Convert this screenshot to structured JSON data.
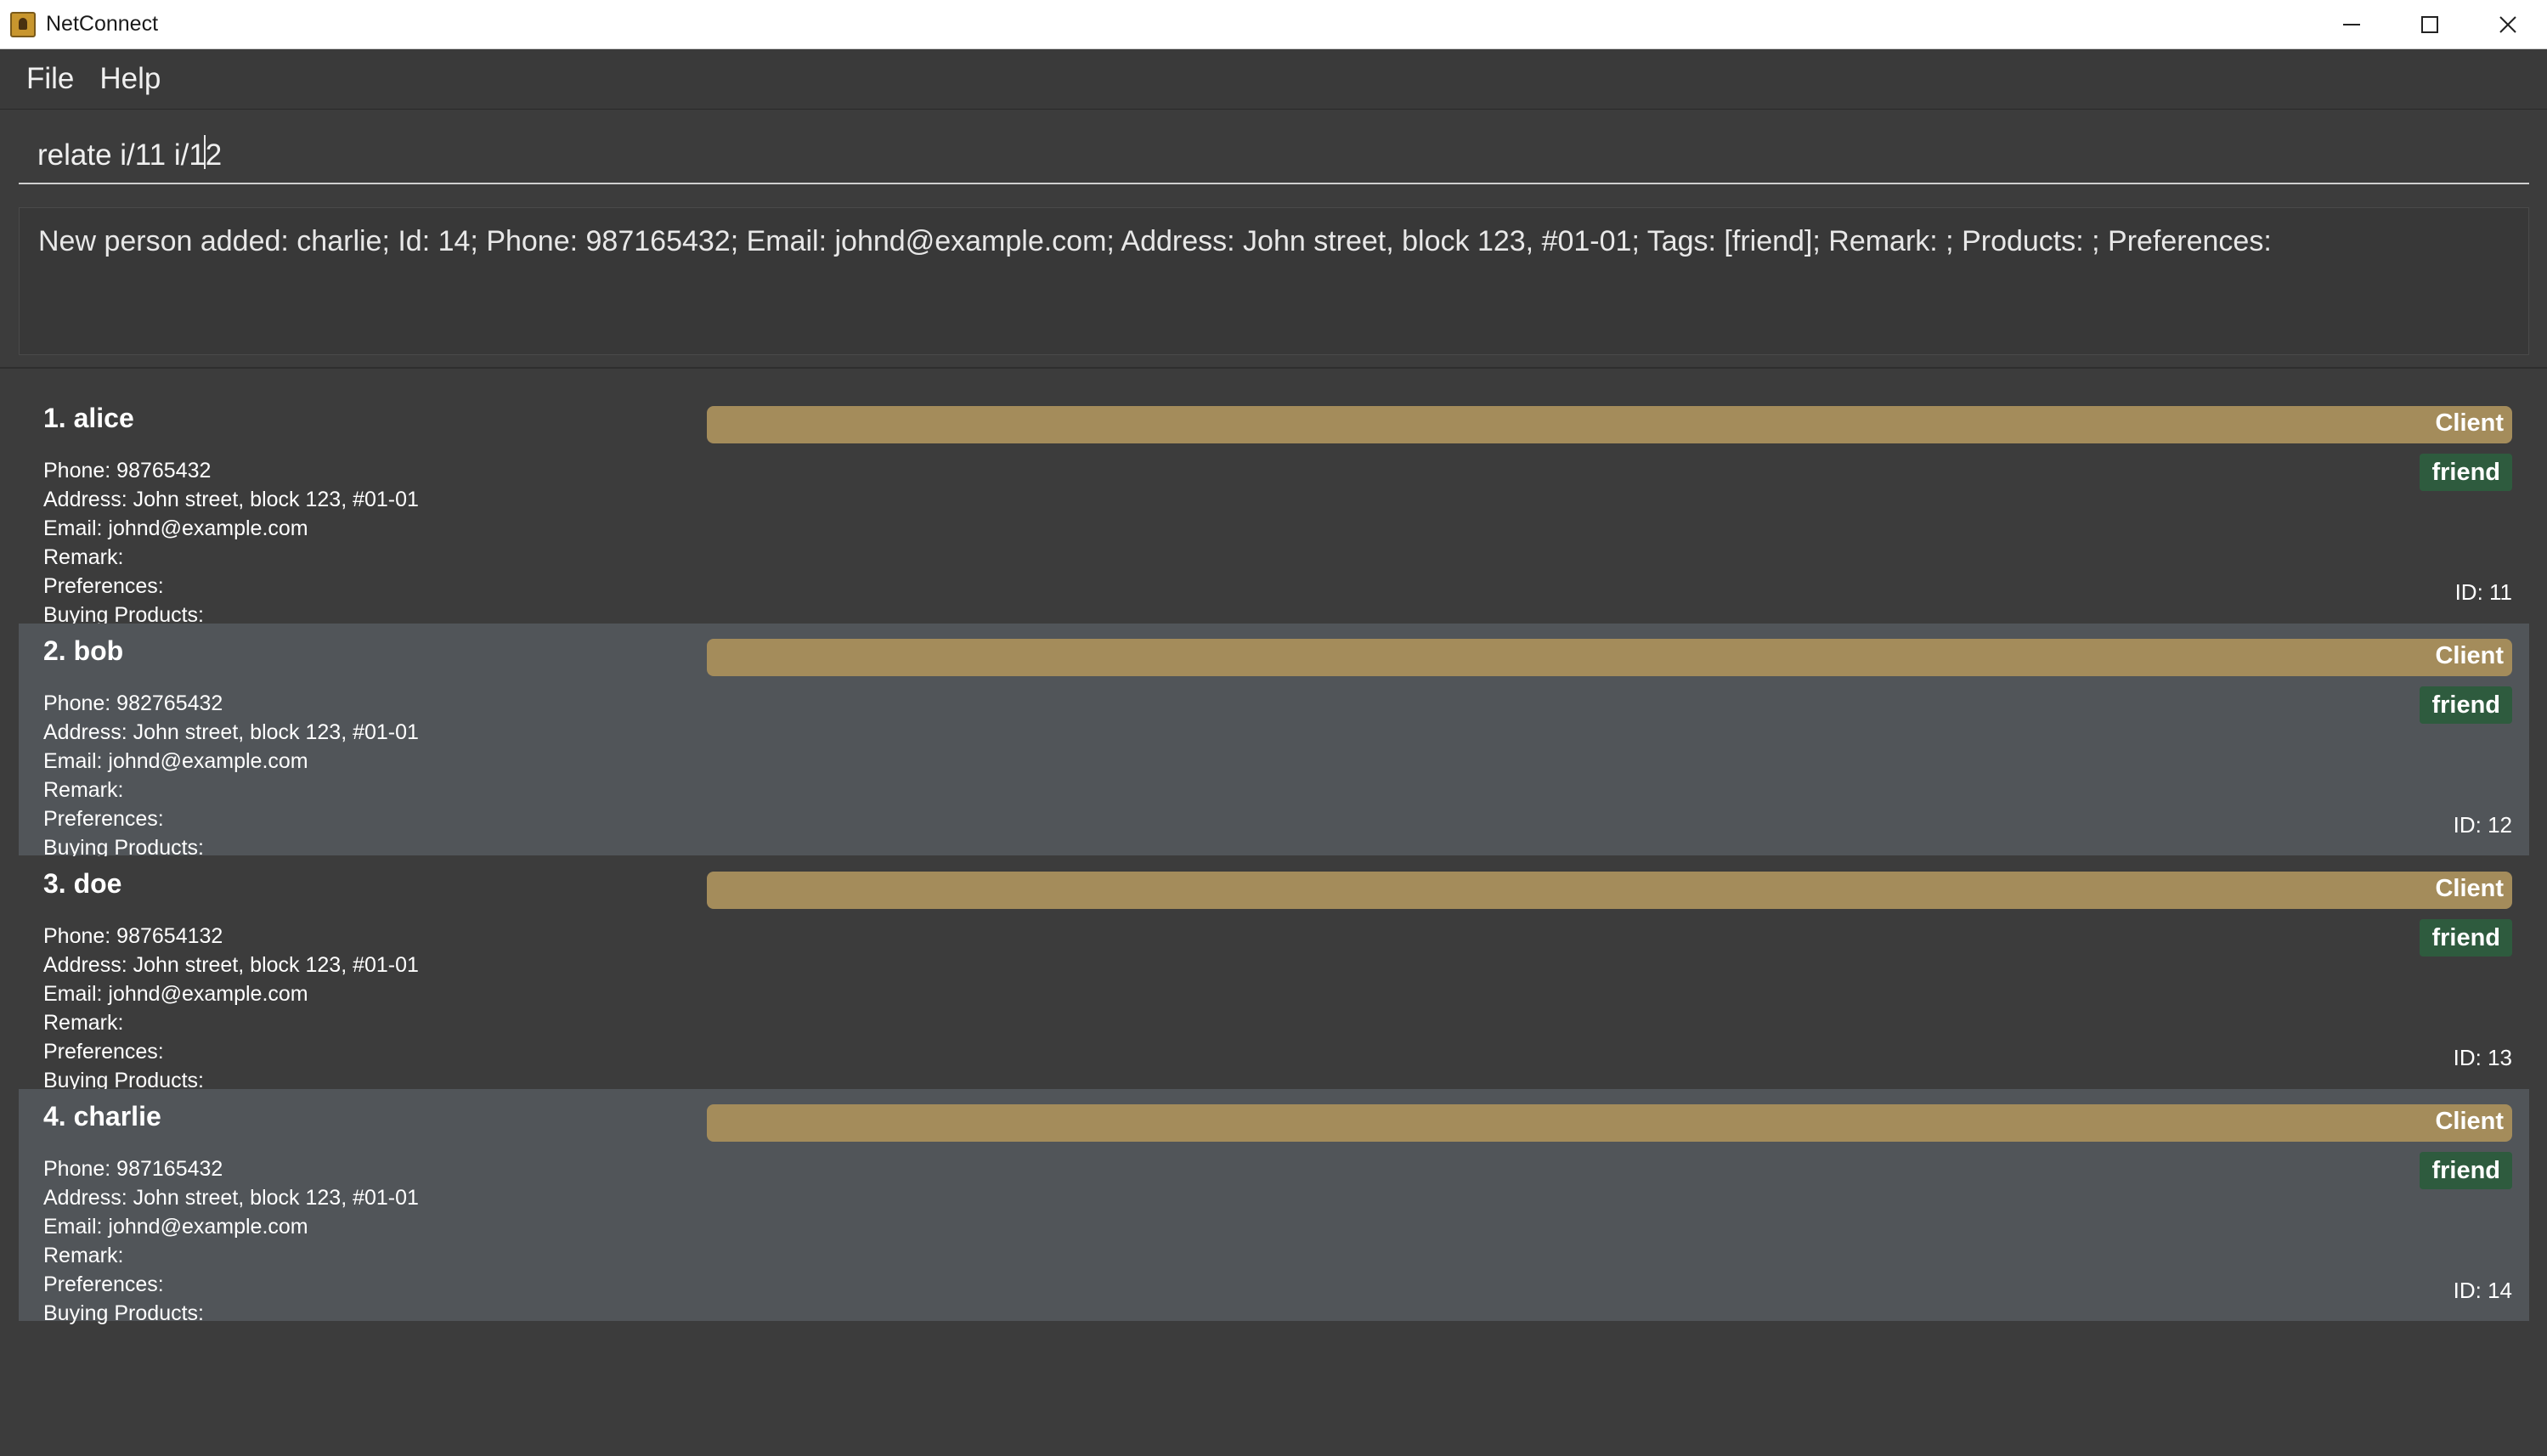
{
  "window": {
    "title": "NetConnect",
    "controls": [
      "minimize",
      "maximize",
      "close"
    ]
  },
  "menu": {
    "file": "File",
    "help": "Help"
  },
  "command": {
    "value": "relate i/11 i/12"
  },
  "result": {
    "text": "New person added: charlie; Id: 14; Phone: 987165432; Email: johnd@example.com; Address: John street, block 123, #01-01; Tags: [friend]; Remark: ; Products: ; Preferences:"
  },
  "persons": [
    {
      "name": "1.  alice",
      "phone": "Phone: 98765432",
      "address": "Address: John street, block 123, #01-01",
      "email": "Email: johnd@example.com",
      "remark": "Remark:",
      "preferences": "Preferences:",
      "products": "Buying Products:",
      "role": "Client",
      "tag": "friend",
      "id": "ID: 11"
    },
    {
      "name": "2.  bob",
      "phone": "Phone: 982765432",
      "address": "Address: John street, block 123, #01-01",
      "email": "Email: johnd@example.com",
      "remark": "Remark:",
      "preferences": "Preferences:",
      "products": "Buying Products:",
      "role": "Client",
      "tag": "friend",
      "id": "ID: 12"
    },
    {
      "name": "3.  doe",
      "phone": "Phone: 987654132",
      "address": "Address: John street, block 123, #01-01",
      "email": "Email: johnd@example.com",
      "remark": "Remark:",
      "preferences": "Preferences:",
      "products": "Buying Products:",
      "role": "Client",
      "tag": "friend",
      "id": "ID: 13"
    },
    {
      "name": "4.  charlie",
      "phone": "Phone: 987165432",
      "address": "Address: John street, block 123, #01-01",
      "email": "Email: johnd@example.com",
      "remark": "Remark:",
      "preferences": "Preferences:",
      "products": "Buying Products:",
      "role": "Client",
      "tag": "friend",
      "id": "ID: 14"
    }
  ],
  "colors": {
    "background": "#3c3c3c",
    "card_alt": "#515559",
    "client_bar": "#a48c5b",
    "tag": "#2e5b3e"
  }
}
